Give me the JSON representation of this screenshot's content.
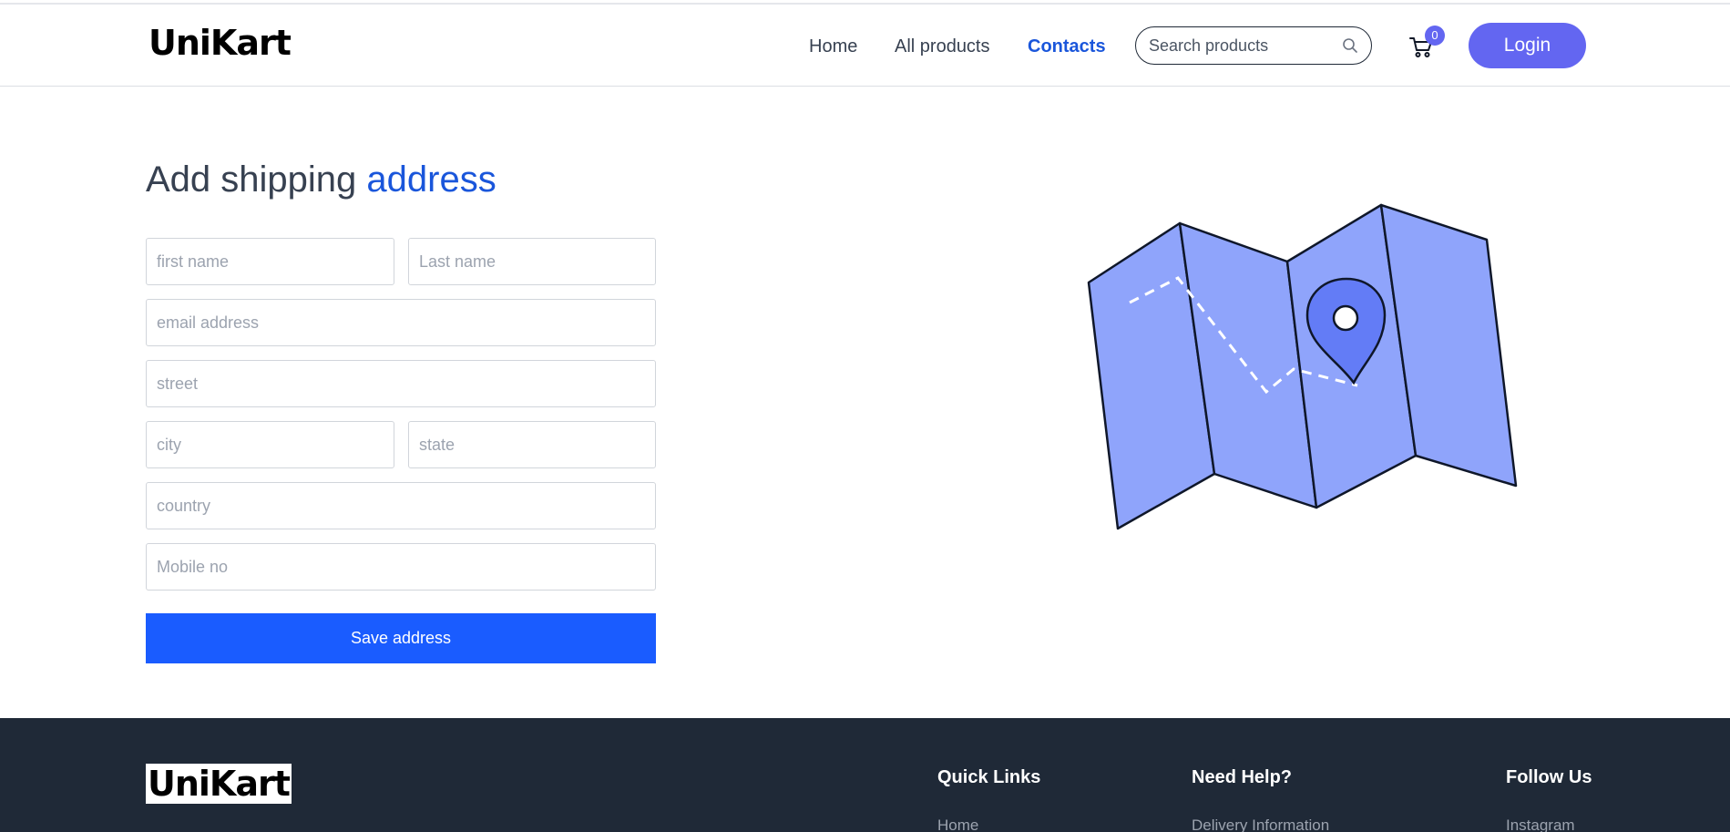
{
  "brand": {
    "name": "UniKart"
  },
  "nav": {
    "items": [
      {
        "label": "Home",
        "active": false
      },
      {
        "label": "All products",
        "active": false
      },
      {
        "label": "Contacts",
        "active": true
      }
    ],
    "search_placeholder": "Search products",
    "search_icon": "search-icon",
    "cart_icon": "cart-icon",
    "cart_count": "0",
    "login_label": "Login"
  },
  "form": {
    "title_main": "Add shipping",
    "title_accent": "address",
    "first_name_placeholder": "first name",
    "last_name_placeholder": "Last name",
    "email_placeholder": "email address",
    "street_placeholder": "street",
    "city_placeholder": "city",
    "state_placeholder": "state",
    "country_placeholder": "country",
    "mobile_placeholder": "Mobile no",
    "save_label": "Save address"
  },
  "illustration": {
    "icon": "folded-map-with-location-pin"
  },
  "footer": {
    "brand": "UniKart",
    "columns": [
      {
        "heading": "Quick Links",
        "first_link": "Home"
      },
      {
        "heading": "Need Help?",
        "first_link": "Delivery Information"
      },
      {
        "heading": "Follow Us",
        "first_link": "Instagram"
      }
    ]
  },
  "colors": {
    "accent": "#1a56db",
    "button_primary": "#1a5cff",
    "login_button": "#6366f1",
    "map_fill": "#8fa4fb",
    "pin_fill": "#637cf6",
    "footer_bg": "#1f2937"
  }
}
